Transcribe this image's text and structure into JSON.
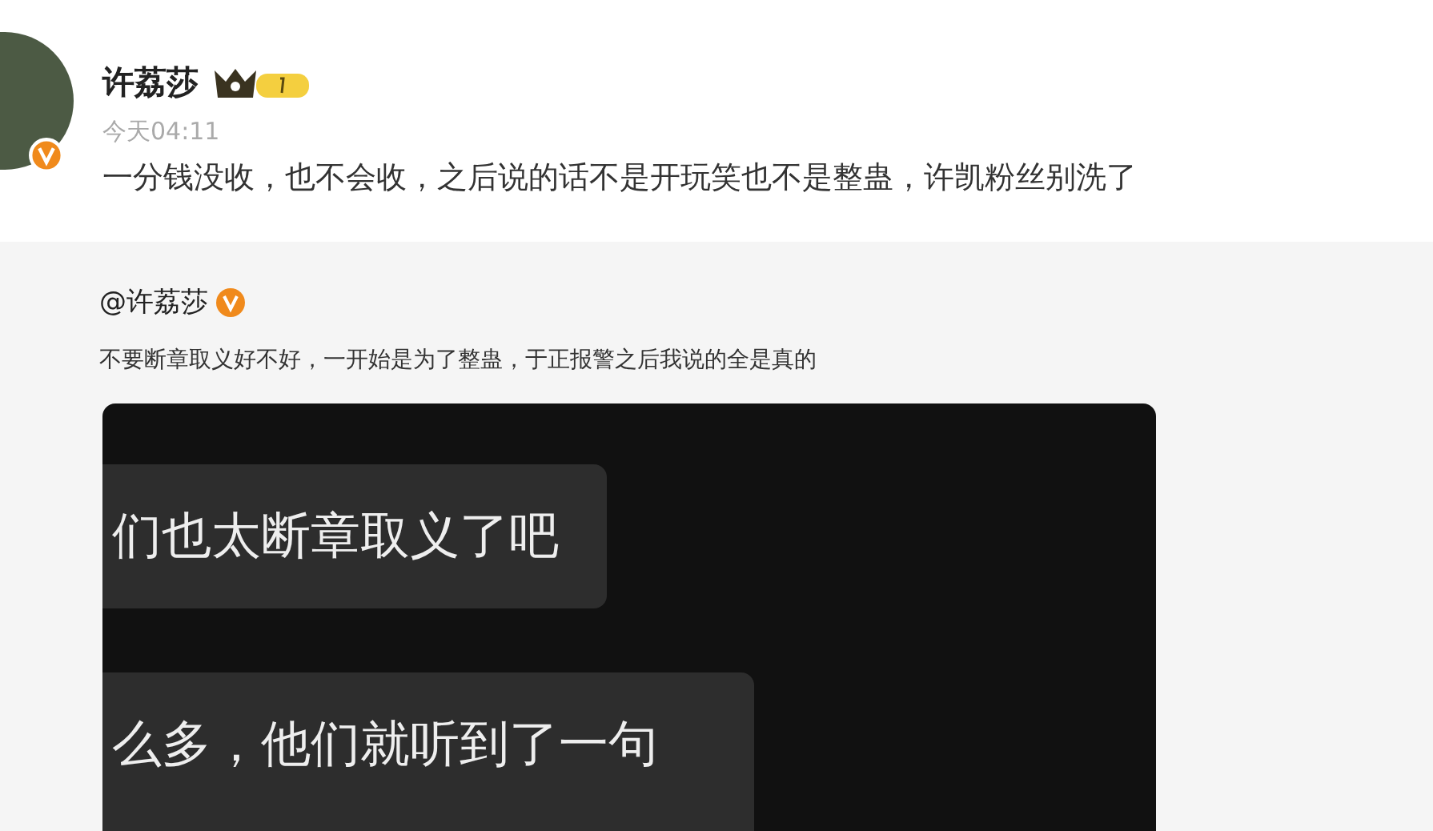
{
  "post": {
    "author": "许荔莎",
    "verified": true,
    "time": "今天04:11",
    "text": "一分钱没收，也不会收，之后说的话不是开玩笑也不是整蛊，许凯粉丝别洗了"
  },
  "repost": {
    "author": "@许荔莎",
    "verified": true,
    "text": "不要断章取义好不好，一开始是为了整蛊，于正报警之后我说的全是真的",
    "chat_messages": [
      "们也太断章取义了吧",
      "么多，他们就听到了一句"
    ]
  }
}
